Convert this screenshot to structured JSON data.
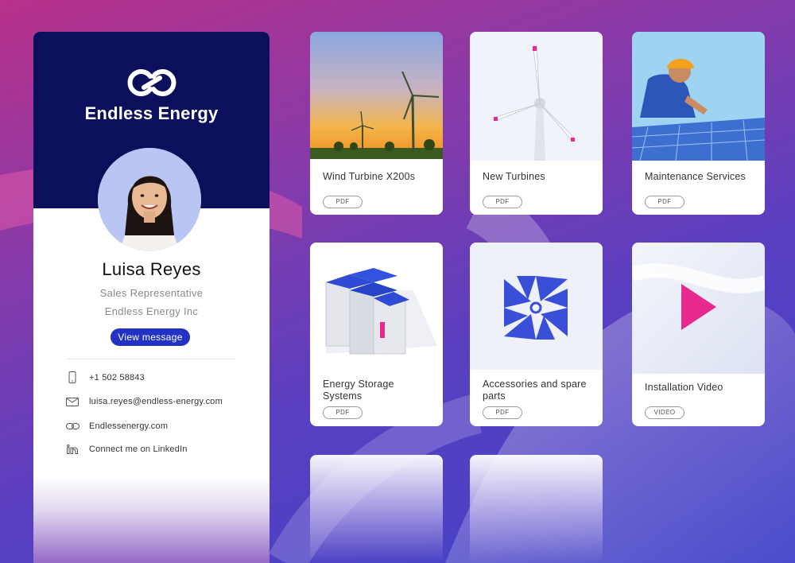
{
  "profile": {
    "brand": "Endless Energy",
    "name": "Luisa Reyes",
    "role": "Sales Representative",
    "company": "Endless Energy Inc",
    "view_button": "View message",
    "contacts": [
      {
        "icon": "phone-icon",
        "text": "+1 502 58843"
      },
      {
        "icon": "mail-icon",
        "text": "luisa.reyes@endless-energy.com"
      },
      {
        "icon": "link-icon",
        "text": "Endlessenergy.com"
      },
      {
        "icon": "linkedin-icon",
        "text": "Connect me on LinkedIn"
      }
    ]
  },
  "tiles": [
    {
      "title": "Wind Turbine X200s",
      "badge": "PDF"
    },
    {
      "title": "New Turbines",
      "badge": "PDF"
    },
    {
      "title": "Maintenance Services",
      "badge": "PDF"
    },
    {
      "title": "Energy Storage Systems",
      "badge": "PDF"
    },
    {
      "title": "Accessories and spare parts",
      "badge": "PDF"
    },
    {
      "title": "Installation Video",
      "badge": "VIDEO"
    }
  ],
  "colors": {
    "navy": "#0b0f5c",
    "accent_blue": "#2233c4",
    "play_pink": "#e8288f"
  }
}
